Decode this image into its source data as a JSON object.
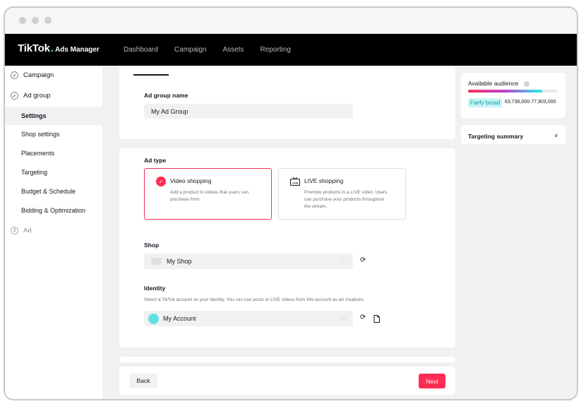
{
  "brand": {
    "main": "TikTok",
    "dot": ".",
    "sub": "Ads Manager"
  },
  "nav": {
    "items": [
      "Dashboard",
      "Campaign",
      "Assets",
      "Reporting"
    ]
  },
  "sidebar": {
    "steps": [
      {
        "label": "Campaign",
        "state": "done"
      },
      {
        "label": "Ad group",
        "state": "done"
      },
      {
        "label": "Ad",
        "state": "pending",
        "number": "3"
      }
    ],
    "subitems": [
      "Settings",
      "Shop settings",
      "Placements",
      "Targeting",
      "Budget & Schedule",
      "Bidding & Optimization"
    ],
    "active_subitem": "Settings"
  },
  "adgroup": {
    "label": "Ad group name",
    "value": "My Ad Group"
  },
  "adtype": {
    "label": "Ad type",
    "options": [
      {
        "title": "Video shopping",
        "desc": "Add a product to videos that users can purchase from",
        "selected": true
      },
      {
        "title": "LIVE shopping",
        "desc": "Promote products in a LIVE video. Users can purchase your products throughout the stream.",
        "selected": false,
        "icon_text": "LIVE"
      }
    ]
  },
  "shop": {
    "label": "Shop",
    "value": "My Shop"
  },
  "identity": {
    "label": "Identity",
    "hint": "Select a TikTok account as your identity. You can use posts or LIVE videos from this account as ad creatives.",
    "value": "My Account"
  },
  "footer": {
    "back": "Back",
    "next": "Next"
  },
  "audience": {
    "title": "Available audience",
    "badge": "Fairly broad",
    "range": "63,738,000-77,903,000",
    "level": 0.83
  },
  "summary": {
    "title": "Targeting summary"
  },
  "colors": {
    "accent": "#fe2c55",
    "brand_cyan": "#25f4ee",
    "nav_bg": "#000000"
  },
  "icons": [
    "check-icon",
    "refresh-icon",
    "file-icon",
    "chevron-down-icon",
    "double-chevron-down-icon",
    "info-icon",
    "live-tv-icon"
  ]
}
